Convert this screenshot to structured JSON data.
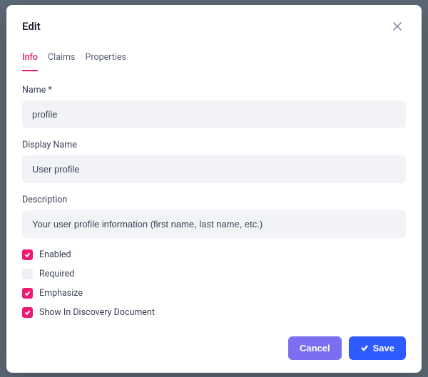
{
  "modal": {
    "title": "Edit"
  },
  "tabs": [
    {
      "label": "Info",
      "active": true
    },
    {
      "label": "Claims",
      "active": false
    },
    {
      "label": "Properties",
      "active": false
    }
  ],
  "fields": {
    "name": {
      "label": "Name *",
      "value": "profile"
    },
    "displayName": {
      "label": "Display Name",
      "value": "User profile"
    },
    "description": {
      "label": "Description",
      "value": "Your user profile information (first name, last name, etc.)"
    }
  },
  "checks": {
    "enabled": {
      "label": "Enabled",
      "checked": true
    },
    "required": {
      "label": "Required",
      "checked": false
    },
    "emphasize": {
      "label": "Emphasize",
      "checked": true
    },
    "showInDiscovery": {
      "label": "Show In Discovery Document",
      "checked": true
    }
  },
  "buttons": {
    "cancel": "Cancel",
    "save": "Save"
  },
  "colors": {
    "accent": "#ec1a72",
    "primary": "#2d5bff",
    "secondary": "#7a6ff0",
    "inputBg": "#f1f3f6"
  }
}
